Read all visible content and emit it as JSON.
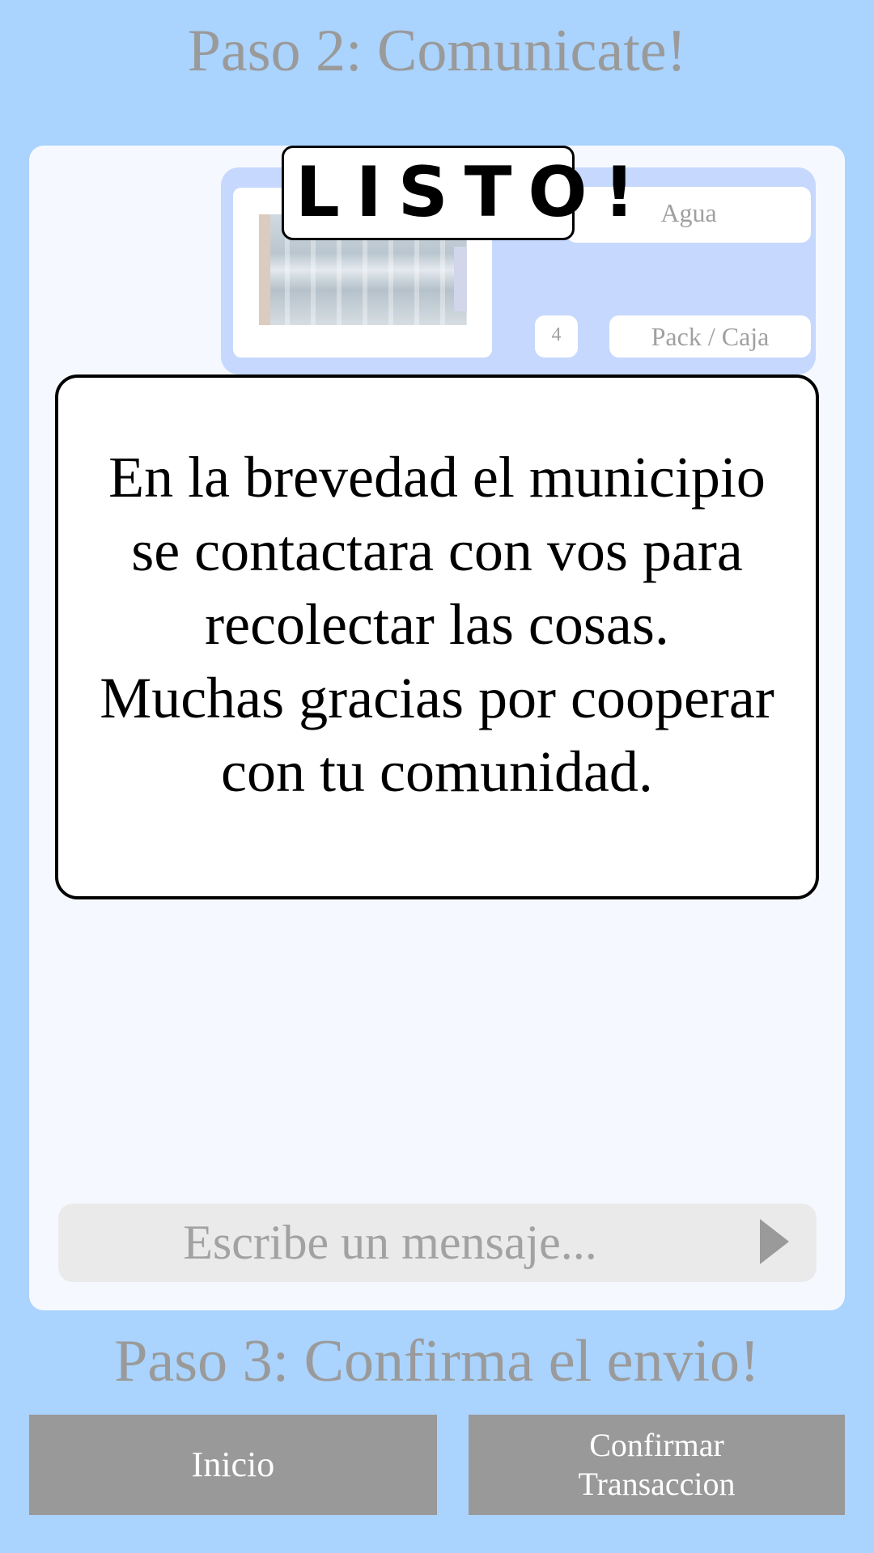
{
  "header": {
    "step2_title": "Paso 2: Comunicate!"
  },
  "item": {
    "name": "Agua",
    "quantity": "4",
    "unit": "Pack / Caja",
    "photo_icon": "water-bottles-photo"
  },
  "overlay": {
    "badge": "LISTO!",
    "message": "En la brevedad el municipio\nse contactara con vos para\nrecolectar las cosas.\nMuchas gracias por cooperar\ncon tu comunidad."
  },
  "composer": {
    "placeholder": "Escribe un mensaje...",
    "send_icon": "send-triangle-icon"
  },
  "footer": {
    "step3_title": "Paso 3: Confirma el envio!",
    "home_label": "Inicio",
    "confirm_label_line1": "Confirmar",
    "confirm_label_line2": "Transaccion"
  },
  "colors": {
    "background": "#aad3fe",
    "panel": "#f5f9ff",
    "item_card": "#c6d8fd",
    "button": "#999999",
    "title_text": "#9a9a9a"
  }
}
